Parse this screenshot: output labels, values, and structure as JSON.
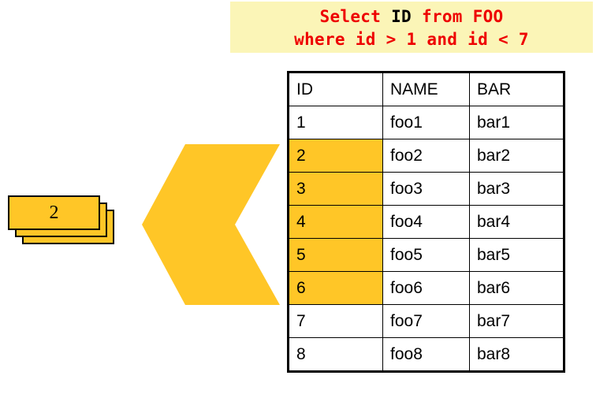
{
  "query": {
    "line1_prefix": "Select ",
    "line1_highlight": "ID",
    "line1_suffix": " from FOO",
    "line2": "where id > 1 and id < 7",
    "background_color": "#fbf5b7",
    "text_color": "#ee0000",
    "highlight_text_color": "#000000"
  },
  "table": {
    "columns": [
      "ID",
      "NAME",
      "BAR"
    ],
    "rows": [
      {
        "id": "1",
        "name": "foo1",
        "bar": "bar1",
        "selected": false
      },
      {
        "id": "2",
        "name": "foo2",
        "bar": "bar2",
        "selected": true
      },
      {
        "id": "3",
        "name": "foo3",
        "bar": "bar3",
        "selected": true
      },
      {
        "id": "4",
        "name": "foo4",
        "bar": "bar4",
        "selected": true
      },
      {
        "id": "5",
        "name": "foo5",
        "bar": "bar5",
        "selected": true
      },
      {
        "id": "6",
        "name": "foo6",
        "bar": "bar6",
        "selected": true
      },
      {
        "id": "7",
        "name": "foo7",
        "bar": "bar7",
        "selected": false
      },
      {
        "id": "8",
        "name": "foo8",
        "bar": "bar8",
        "selected": false
      }
    ],
    "highlight_color": "#ffc627",
    "border_color": "#000000"
  },
  "arrow": {
    "icon": "chevron-left-icon",
    "direction": "left",
    "color": "#ffc627"
  },
  "result_stack": {
    "label": "2",
    "card_count": 3,
    "fill_color": "#ffc627",
    "border_color": "#000000"
  }
}
